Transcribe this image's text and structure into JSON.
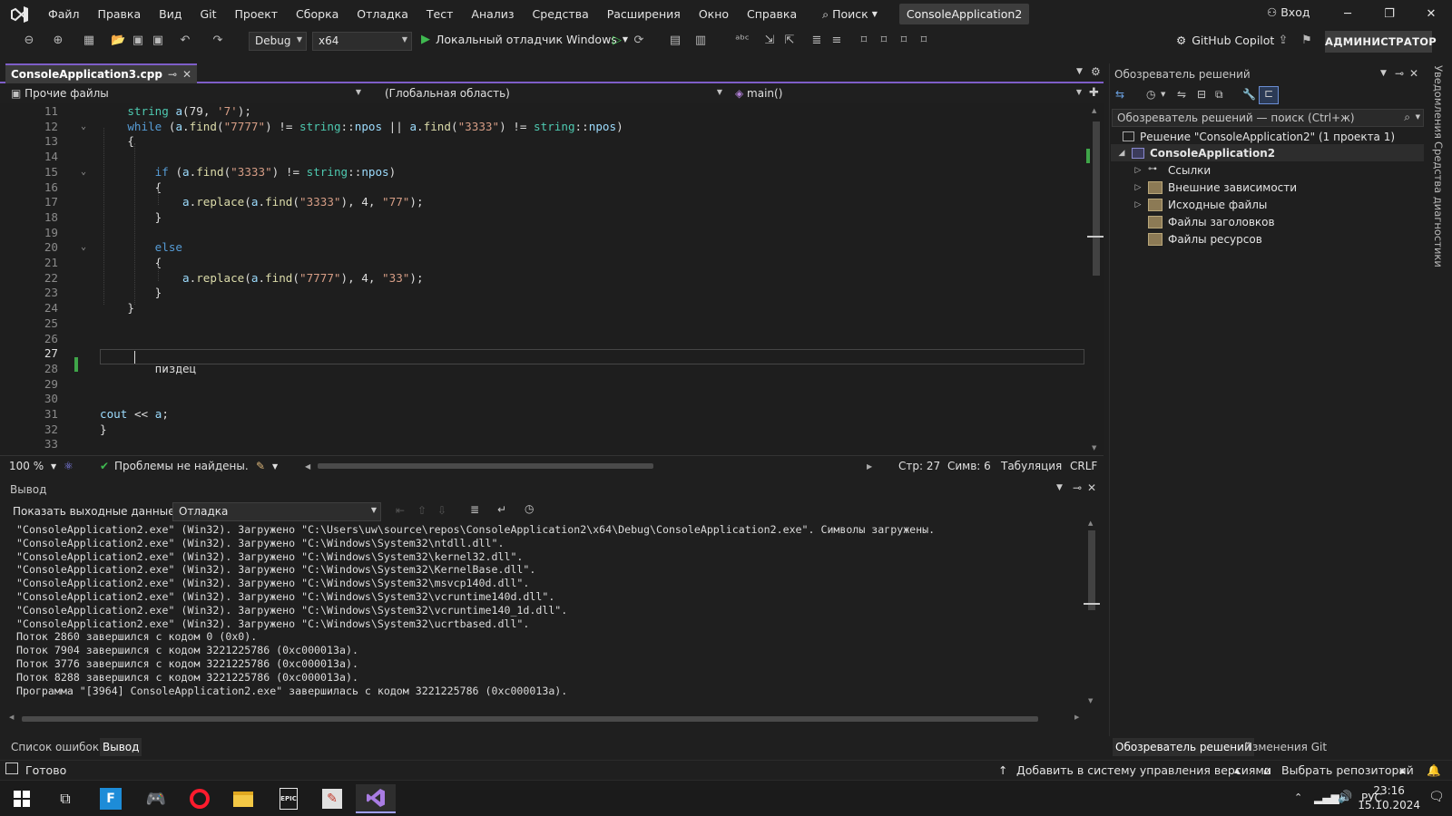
{
  "menu": {
    "items": [
      "Файл",
      "Правка",
      "Вид",
      "Git",
      "Проект",
      "Сборка",
      "Отладка",
      "Тест",
      "Анализ",
      "Средства",
      "Расширения",
      "Окно",
      "Справка"
    ],
    "search_label": "Поиск",
    "solution_chip": "ConsoleApplication2",
    "login_label": "Вход"
  },
  "toolbar": {
    "config": "Debug",
    "platform": "x64",
    "run_label": "Локальный отладчик Windows",
    "copilot_label": "GitHub Copilot",
    "admin_label": "АДМИНИСТРАТОР"
  },
  "editor": {
    "tab_label": "ConsoleApplication3.cpp",
    "nav_project": "Прочие файлы",
    "nav_scope": "(Глобальная область)",
    "nav_member": "main()",
    "current_line": 27,
    "zoom": "100 %",
    "issues": "Проблемы не найдены.",
    "status_line": "Стр: 27",
    "status_col": "Симв: 6",
    "status_indent": "Табуляция",
    "status_eol": "CRLF"
  },
  "code_lines": [
    {
      "n": "11",
      "text": "    string a(79, '7');"
    },
    {
      "n": "12",
      "text": "    while (a.find(\"7777\") != string::npos || a.find(\"3333\") != string::npos)"
    },
    {
      "n": "13",
      "text": "    {"
    },
    {
      "n": "14",
      "text": ""
    },
    {
      "n": "15",
      "text": "        if (a.find(\"3333\") != string::npos)"
    },
    {
      "n": "16",
      "text": "        {"
    },
    {
      "n": "17",
      "text": "            a.replace(a.find(\"3333\"), 4, \"77\");"
    },
    {
      "n": "18",
      "text": "        }"
    },
    {
      "n": "19",
      "text": ""
    },
    {
      "n": "20",
      "text": "        else"
    },
    {
      "n": "21",
      "text": "        {"
    },
    {
      "n": "22",
      "text": "            a.replace(a.find(\"7777\"), 4, \"33\");"
    },
    {
      "n": "23",
      "text": "        }"
    },
    {
      "n": "24",
      "text": "    }"
    },
    {
      "n": "25",
      "text": ""
    },
    {
      "n": "26",
      "text": ""
    },
    {
      "n": "27",
      "text": ""
    },
    {
      "n": "28",
      "text": "        пиздец"
    },
    {
      "n": "29",
      "text": ""
    },
    {
      "n": "30",
      "text": ""
    },
    {
      "n": "31",
      "text": "cout << a;"
    },
    {
      "n": "32",
      "text": "}"
    },
    {
      "n": "33",
      "text": ""
    }
  ],
  "output": {
    "title": "Вывод",
    "source_label": "Показать выходные данные из:",
    "source_value": "Отладка",
    "lines": [
      "\"ConsoleApplication2.exe\" (Win32). Загружено \"C:\\Users\\uw\\source\\repos\\ConsoleApplication2\\x64\\Debug\\ConsoleApplication2.exe\". Символы загружены.",
      "\"ConsoleApplication2.exe\" (Win32). Загружено \"C:\\Windows\\System32\\ntdll.dll\".",
      "\"ConsoleApplication2.exe\" (Win32). Загружено \"C:\\Windows\\System32\\kernel32.dll\".",
      "\"ConsoleApplication2.exe\" (Win32). Загружено \"C:\\Windows\\System32\\KernelBase.dll\".",
      "\"ConsoleApplication2.exe\" (Win32). Загружено \"C:\\Windows\\System32\\msvcp140d.dll\".",
      "\"ConsoleApplication2.exe\" (Win32). Загружено \"C:\\Windows\\System32\\vcruntime140d.dll\".",
      "\"ConsoleApplication2.exe\" (Win32). Загружено \"C:\\Windows\\System32\\vcruntime140_1d.dll\".",
      "\"ConsoleApplication2.exe\" (Win32). Загружено \"C:\\Windows\\System32\\ucrtbased.dll\".",
      "Поток 2860 завершился с кодом 0 (0x0).",
      "Поток 7904 завершился с кодом 3221225786 (0xc000013a).",
      "Поток 3776 завершился с кодом 3221225786 (0xc000013a).",
      "Поток 8288 завершился с кодом 3221225786 (0xc000013a).",
      "Программа \"[3964] ConsoleApplication2.exe\" завершилась с кодом 3221225786 (0xc000013a)."
    ],
    "tab_errors": "Список ошибок",
    "tab_output": "Вывод"
  },
  "solution_explorer": {
    "title": "Обозреватель решений",
    "search_placeholder": "Обозреватель решений — поиск (Ctrl+ж)",
    "solution_label": "Решение \"ConsoleApplication2\" (1 проекта 1)",
    "project_label": "ConsoleApplication2",
    "items": [
      "Ссылки",
      "Внешние зависимости",
      "Исходные файлы",
      "Файлы заголовков",
      "Файлы ресурсов"
    ],
    "tab_explorer": "Обозреватель решений",
    "tab_git": "Изменения Git"
  },
  "side_bar": {
    "notifications": "Уведомления",
    "diagnostics": "Средства диагностики"
  },
  "status": {
    "ready": "Готово",
    "add_vcs": "Добавить в систему управления версиями",
    "select_repo": "Выбрать репозиторий"
  },
  "taskbar": {
    "lang": "РУС",
    "time": "23:16",
    "date": "15.10.2024"
  },
  "colors": {
    "accent": "#7e5ec8",
    "keyword": "#569cd6",
    "string": "#d69d85",
    "type": "#4ec9b0",
    "change_marker": "#3fa549"
  }
}
